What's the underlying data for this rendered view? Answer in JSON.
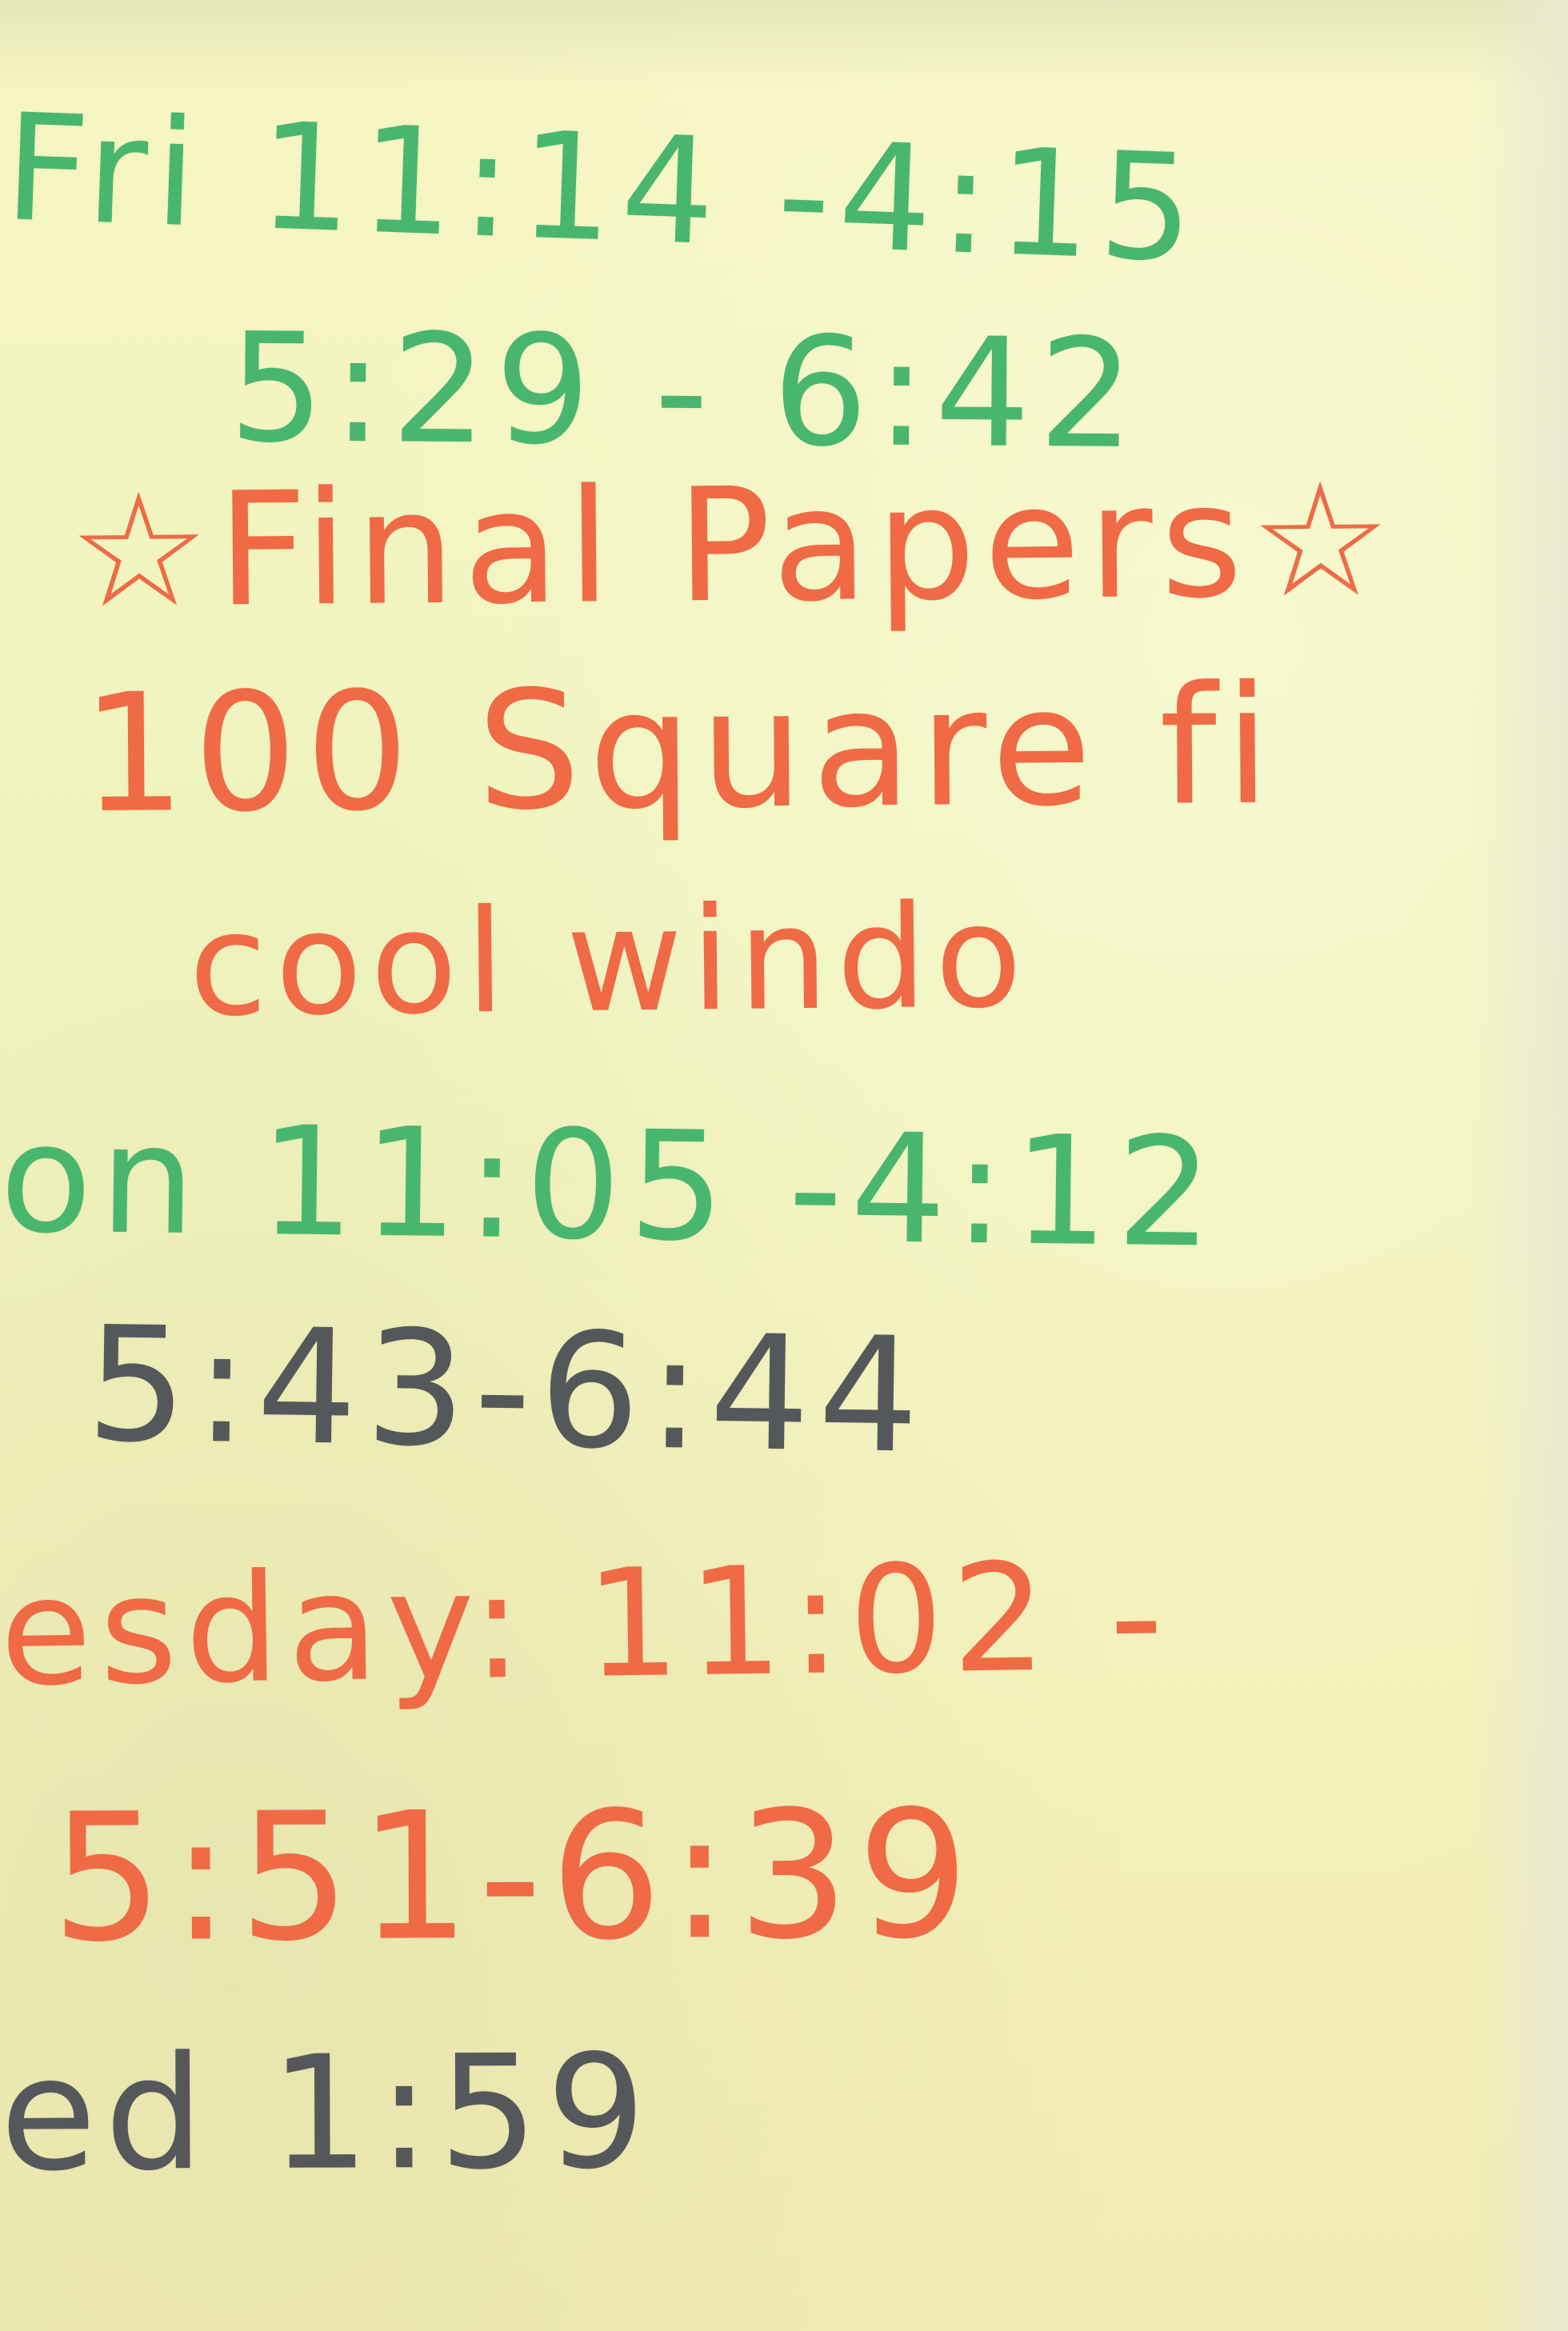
{
  "note": {
    "lines": [
      {
        "text": "Fri 11:14 -4:15"
      },
      {
        "text": "5:29 - 6:42"
      },
      {
        "text": "☆Final Papers☆"
      },
      {
        "text": "100 Square fi"
      },
      {
        "text": "cool windo"
      },
      {
        "text": "on 11:05 -4:12"
      },
      {
        "text": "5:43-6:44"
      },
      {
        "text": "esday: 11:02 -"
      },
      {
        "text": "5:51-6:39"
      },
      {
        "text": "ed 1:59"
      }
    ],
    "ink_colors": {
      "green": "#48b76d",
      "coral": "#ef6a45",
      "charcoal": "#55585a"
    }
  }
}
